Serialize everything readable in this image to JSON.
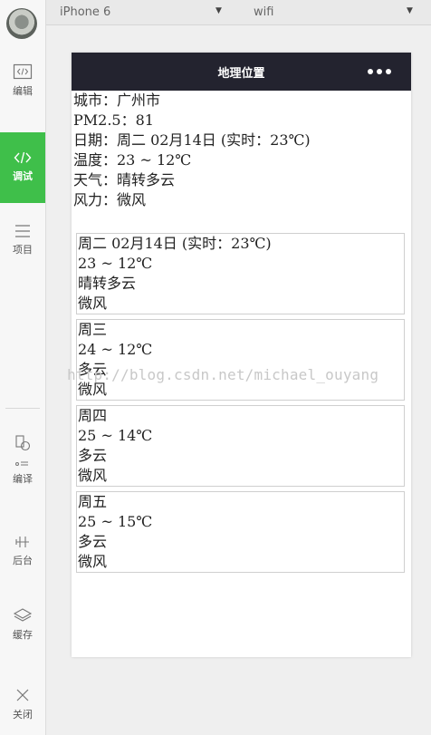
{
  "topbar": {
    "device": "iPhone 6",
    "network": "wifi"
  },
  "sidebar": {
    "items": [
      {
        "label": "编辑",
        "icon": "code-editor-icon"
      },
      {
        "label": "调试",
        "icon": "debug-icon",
        "active": true
      },
      {
        "label": "项目",
        "icon": "menu-lines-icon"
      },
      {
        "label": "编译",
        "icon": "compile-icon"
      },
      {
        "label": "后台",
        "icon": "background-icon"
      },
      {
        "label": "缓存",
        "icon": "layers-icon"
      },
      {
        "label": "关闭",
        "icon": "close-icon"
      }
    ]
  },
  "phone": {
    "title": "地理位置",
    "info": {
      "city": "城市：广州市",
      "pm25": "PM2.5：81",
      "date": "日期：周二 02月14日 (实时：23℃)",
      "temp": "温度：23 ~ 12℃",
      "weather": "天气：晴转多云",
      "wind": "风力：微风"
    },
    "forecast": [
      {
        "date": "周二 02月14日 (实时：23℃)",
        "temp": "23 ~ 12℃",
        "weather": "晴转多云",
        "wind": "微风"
      },
      {
        "date": "周三",
        "temp": "24 ~ 12℃",
        "weather": "多云",
        "wind": "微风"
      },
      {
        "date": "周四",
        "temp": "25 ~ 14℃",
        "weather": "多云",
        "wind": "微风"
      },
      {
        "date": "周五",
        "temp": "25 ~ 15℃",
        "weather": "多云",
        "wind": "微风"
      }
    ]
  },
  "watermark": "http://blog.csdn.net/michael_ouyang",
  "colors": {
    "active": "#3fbf4a",
    "navbar": "#23232f"
  }
}
